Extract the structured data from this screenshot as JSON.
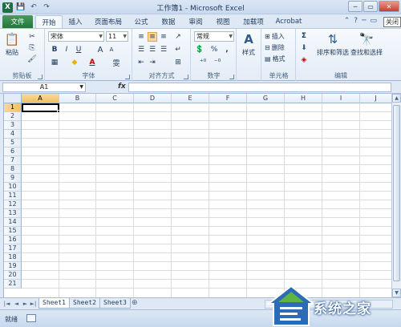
{
  "window": {
    "title": "工作簿1 - Microsoft Excel",
    "controls": [
      "─",
      "▭",
      "✕"
    ]
  },
  "quick_access": {
    "save": "💾",
    "undo": "↶",
    "redo": "↷",
    "app_icon": "X"
  },
  "tabs": {
    "file": "文件",
    "items": [
      "开始",
      "插入",
      "页面布局",
      "公式",
      "数据",
      "审阅",
      "视图",
      "加载项",
      "Acrobat"
    ],
    "active": "开始",
    "tooltip": "关闭"
  },
  "ribbon": {
    "clipboard": {
      "label": "剪贴板",
      "paste": "粘贴"
    },
    "font": {
      "label": "字体",
      "name": "宋体",
      "size": "11",
      "bold": "B",
      "italic": "I",
      "underline": "U",
      "grow": "A",
      "shrink": "A",
      "font_color": "A",
      "wen": "雯"
    },
    "alignment": {
      "label": "对齐方式"
    },
    "number": {
      "label": "数字",
      "format": "常规",
      "percent": "%",
      "comma": ","
    },
    "styles": {
      "label": "样式"
    },
    "cells": {
      "label": "单元格",
      "insert": "插入",
      "delete": "删除",
      "format": "格式"
    },
    "editing": {
      "label": "编辑",
      "sigma": "Σ",
      "sort": "排序和筛选",
      "find": "查找和选择"
    }
  },
  "formula_bar": {
    "name_box": "A1",
    "fx": "fx",
    "content": ""
  },
  "grid": {
    "columns": [
      "A",
      "B",
      "C",
      "D",
      "E",
      "F",
      "G",
      "H",
      "I",
      "J"
    ],
    "rows": [
      "1",
      "2",
      "3",
      "4",
      "5",
      "6",
      "7",
      "8",
      "9",
      "10",
      "11",
      "12",
      "13",
      "14",
      "15",
      "16",
      "17",
      "18",
      "19",
      "20",
      "21"
    ],
    "selected_column": "A",
    "selected_row": "1"
  },
  "sheets": {
    "tabs": [
      "Sheet1",
      "Sheet2",
      "Sheet3"
    ],
    "active": "Sheet1",
    "nav": [
      "◄◄",
      "◄",
      "►",
      "►►"
    ]
  },
  "status": {
    "text": "就绪"
  },
  "watermark": {
    "text": "系统之家"
  }
}
